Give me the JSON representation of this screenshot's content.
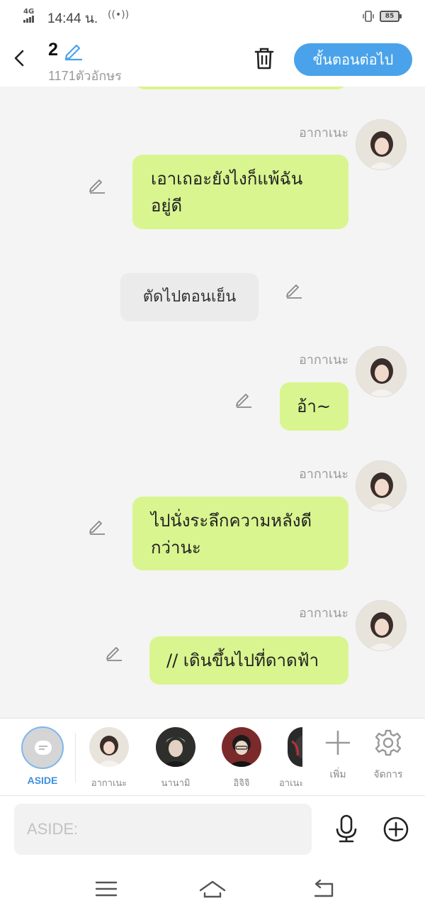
{
  "status": {
    "network": "4G",
    "time": "14:44 น.",
    "battery": "85"
  },
  "header": {
    "title": "2",
    "char_count": "1171ตัวอักษร",
    "next_label": "ขั้นตอนต่อไป"
  },
  "messages": [
    {
      "type": "character",
      "sender": "อากาเนะ",
      "lines": [
        "เอาเถอะยังไงก็แพ้ฉัน",
        "อยู่ดี"
      ]
    },
    {
      "type": "narration",
      "text": "ตัดไปตอนเย็น"
    },
    {
      "type": "character",
      "sender": "อากาเนะ",
      "lines": [
        "อ้า~"
      ]
    },
    {
      "type": "character",
      "sender": "อากาเนะ",
      "lines": [
        "ไปนั่งระลึกความหลังดี",
        "กว่านะ"
      ]
    },
    {
      "type": "character",
      "sender": "อากาเนะ",
      "lines": [
        "// เดินขึ้นไปที่ดาดฟ้า"
      ]
    }
  ],
  "charbar": {
    "aside_label": "ASIDE",
    "characters": [
      {
        "name": "อากาเนะ"
      },
      {
        "name": "นานามิ"
      },
      {
        "name": "อิจิจิ"
      },
      {
        "name": "อาเนะ"
      }
    ],
    "add_label": "เพิ่ม",
    "manage_label": "จัดการ"
  },
  "input": {
    "placeholder": "ASIDE:"
  },
  "colors": {
    "accent": "#4aa3ea",
    "bubble": "#d9f58f",
    "narration": "#ebebeb"
  }
}
